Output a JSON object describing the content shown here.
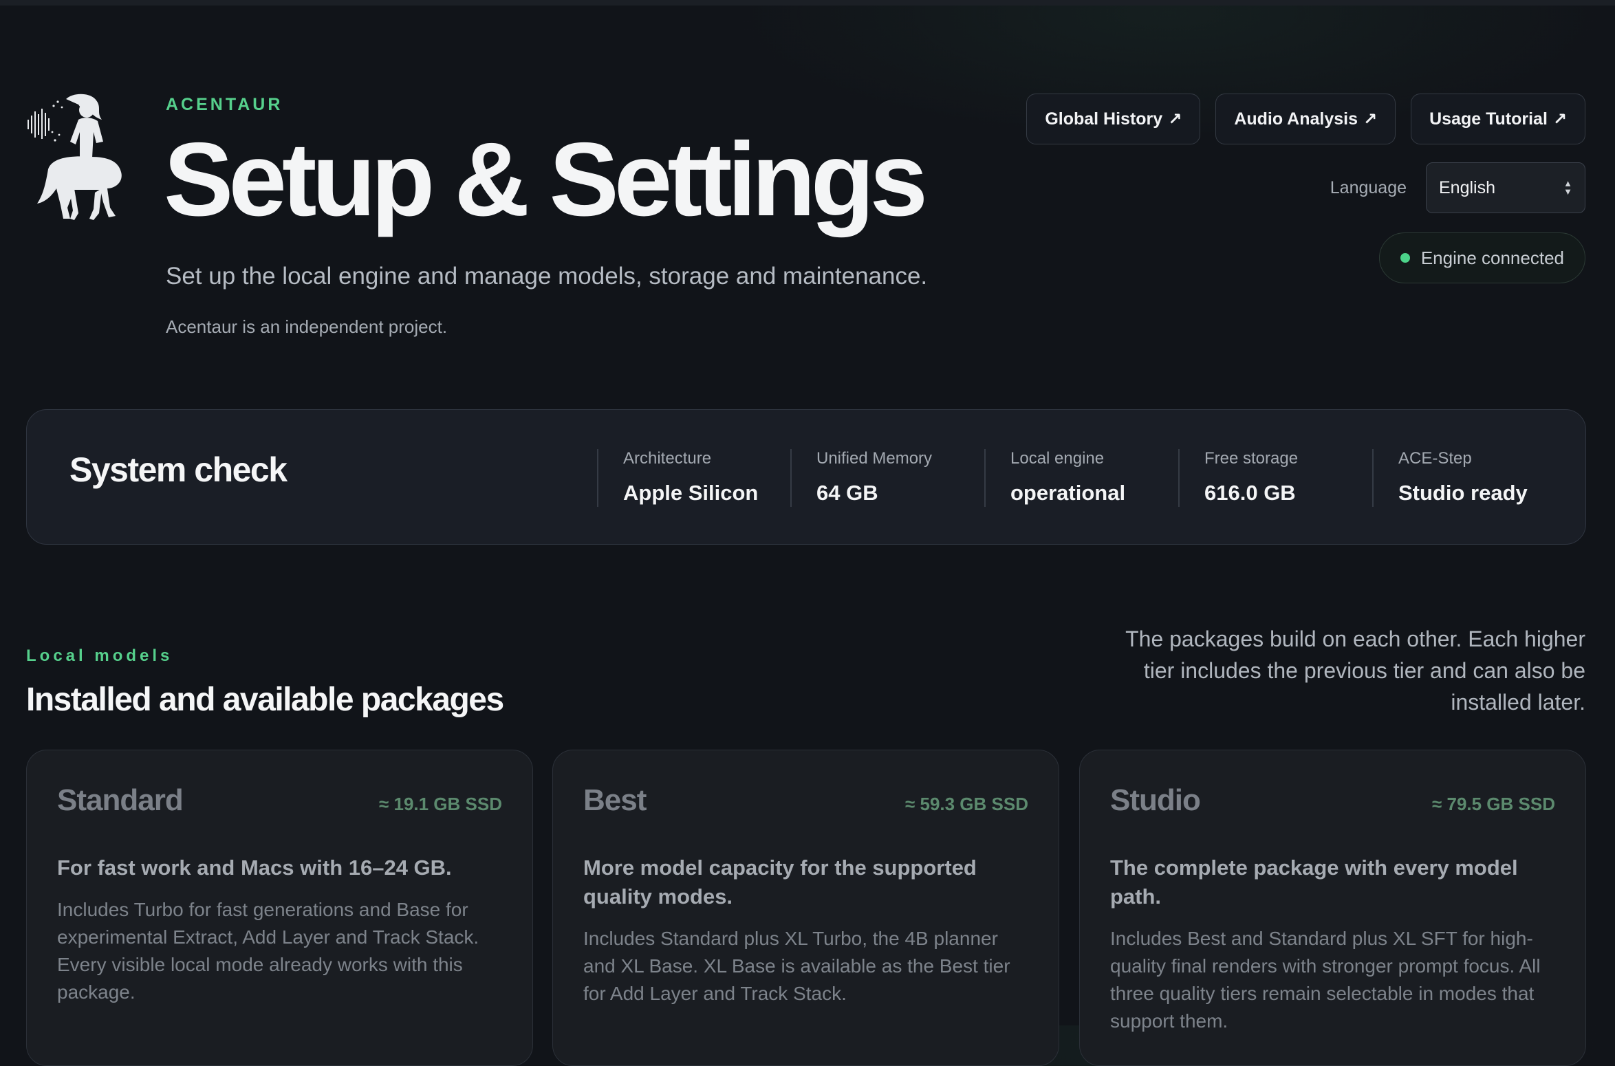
{
  "header": {
    "brand": "ACENTAUR",
    "title": "Setup & Settings",
    "subtitle": "Set up the local engine and manage models, storage and maintenance.",
    "note": "Acentaur is an independent project."
  },
  "nav": {
    "global_history": "Global History",
    "audio_analysis": "Audio Analysis",
    "usage_tutorial": "Usage Tutorial",
    "external_glyph": "↗"
  },
  "language": {
    "label": "Language",
    "selected": "English"
  },
  "engine_status": {
    "text": "Engine connected",
    "color": "#4cd48a"
  },
  "system_check": {
    "title": "System check",
    "stats": [
      {
        "label": "Architecture",
        "value": "Apple Silicon"
      },
      {
        "label": "Unified Memory",
        "value": "64 GB"
      },
      {
        "label": "Local engine",
        "value": "operational"
      },
      {
        "label": "Free storage",
        "value": "616.0 GB"
      },
      {
        "label": "ACE-Step",
        "value": "Studio ready"
      }
    ]
  },
  "models": {
    "eyebrow": "Local models",
    "title": "Installed and available packages",
    "description": "The packages build on each other. Each higher tier includes the previous tier and can also be installed later.",
    "packages": [
      {
        "name": "Standard",
        "size": "≈ 19.1 GB SSD",
        "tagline": "For fast work and Macs with 16–24 GB.",
        "description": "Includes Turbo for fast generations and Base for experimental Extract, Add Layer and Track Stack. Every visible local mode already works with this package."
      },
      {
        "name": "Best",
        "size": "≈ 59.3 GB SSD",
        "tagline": "More model capacity for the supported quality modes.",
        "description": "Includes Standard plus XL Turbo, the 4B planner and XL Base. XL Base is available as the Best tier for Add Layer and Track Stack."
      },
      {
        "name": "Studio",
        "size": "≈ 79.5 GB SSD",
        "tagline": "The complete package with every model path.",
        "description": "Includes Best and Standard plus XL SFT for high-quality final renders with stronger prompt focus. All three quality tiers remain selectable in modes that support them."
      }
    ]
  },
  "colors": {
    "accent": "#56d08c",
    "background": "#111419",
    "card": "#1a1e26"
  }
}
